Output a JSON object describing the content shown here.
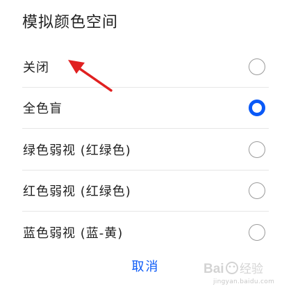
{
  "dialog": {
    "title": "模拟颜色空间",
    "options": [
      {
        "label": "关闭",
        "selected": false
      },
      {
        "label": "全色盲",
        "selected": true
      },
      {
        "label": "绿色弱视 (红绿色)",
        "selected": false
      },
      {
        "label": "红色弱视 (红绿色)",
        "selected": false
      },
      {
        "label": "蓝色弱视 (蓝-黄)",
        "selected": false
      }
    ],
    "cancel_label": "取消"
  },
  "annotation": {
    "icon": "red-arrow-icon",
    "color": "#e02020"
  },
  "watermark": {
    "url": "jingyan.baidu.com"
  },
  "colors": {
    "accent": "#0a59f7",
    "text": "#222222",
    "radio_border": "#9a9a9a",
    "divider": "#e6e6e6"
  }
}
